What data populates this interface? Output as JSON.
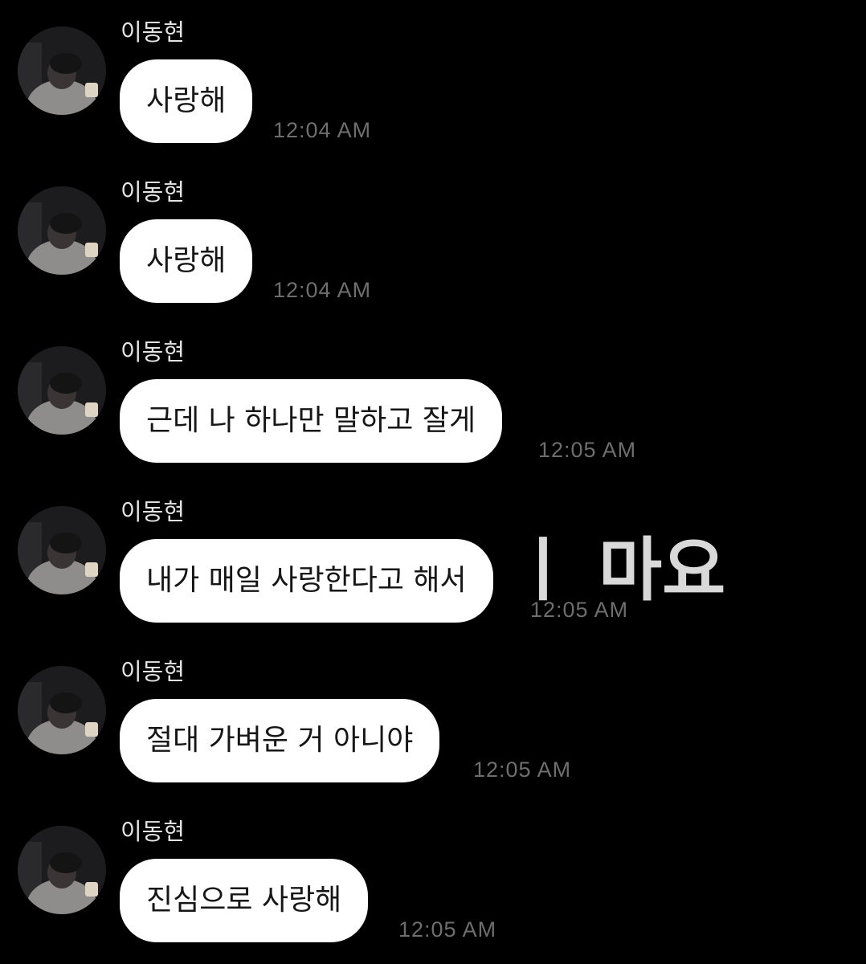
{
  "overlay_caption": "ㅣ 마요",
  "messages": [
    {
      "sender": "이동현",
      "text": "사랑해",
      "time": "12:04 AM"
    },
    {
      "sender": "이동현",
      "text": "사랑해",
      "time": "12:04 AM"
    },
    {
      "sender": "이동현",
      "text": "근데 나 하나만 말하고 잘게",
      "time": "12:05 AM"
    },
    {
      "sender": "이동현",
      "text": "내가 매일 사랑한다고 해서",
      "time": "12:05 AM"
    },
    {
      "sender": "이동현",
      "text": "절대 가벼운 거 아니야",
      "time": "12:05 AM"
    },
    {
      "sender": "이동현",
      "text": "진심으로 사랑해",
      "time": "12:05 AM"
    }
  ]
}
